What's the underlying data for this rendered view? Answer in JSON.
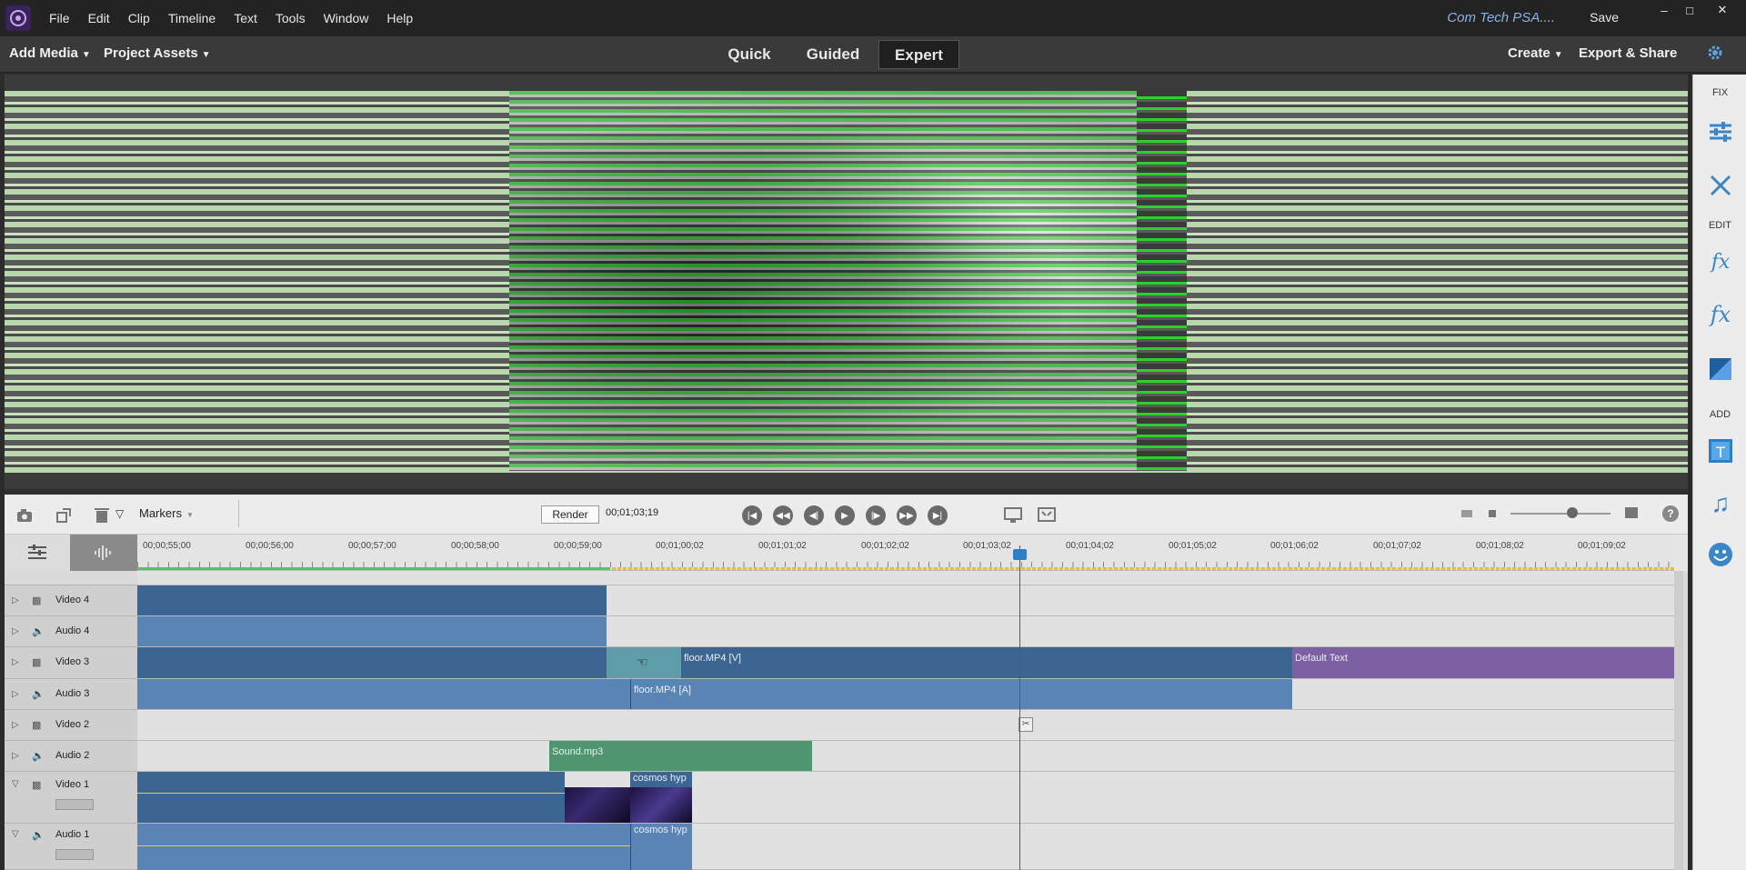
{
  "app": {
    "menu": [
      "File",
      "Edit",
      "Clip",
      "Timeline",
      "Text",
      "Tools",
      "Window",
      "Help"
    ],
    "doc_title": "Com Tech PSA....",
    "save_label": "Save",
    "window_controls": [
      "minimize-icon",
      "maximize-icon",
      "close-icon"
    ]
  },
  "toolbar": {
    "add_media": "Add Media",
    "project_assets": "Project Assets",
    "modes": [
      "Quick",
      "Guided",
      "Expert"
    ],
    "active_mode": "Expert",
    "create": "Create",
    "export_share": "Export & Share"
  },
  "right_panel": {
    "sections": [
      "FIX",
      "EDIT",
      "ADD"
    ],
    "fix_icons": [
      "adjust-sliders-icon",
      "tools-icon"
    ],
    "edit_icons": [
      "applied-effects-icon",
      "effects-icon",
      "transitions-icon"
    ],
    "add_icons": [
      "titles-icon",
      "music-icon",
      "graphics-icon"
    ]
  },
  "timeline_controls": {
    "markers_label": "Markers",
    "render_label": "Render",
    "timecode": "00;01;03;19",
    "transport_icons": [
      "go-to-start-icon",
      "rewind-icon",
      "step-back-icon",
      "play-icon",
      "step-forward-icon",
      "fast-forward-icon",
      "go-to-end-icon"
    ]
  },
  "ruler": {
    "labels": [
      "00;00;55;00",
      "00;00;56;00",
      "00;00;57;00",
      "00;00;58;00",
      "00;00;59;00",
      "00;01;00;02",
      "00;01;01;02",
      "00;01;02;02",
      "00;01;03;02",
      "00;01;04;02",
      "00;01;05;02",
      "00;01;06;02",
      "00;01;07;02",
      "00;01;08;02",
      "00;01;09;02"
    ]
  },
  "tracks": [
    {
      "name": "Video 4",
      "kind": "video"
    },
    {
      "name": "Audio 4",
      "kind": "audio"
    },
    {
      "name": "Video 3",
      "kind": "video"
    },
    {
      "name": "Audio 3",
      "kind": "audio"
    },
    {
      "name": "Video 2",
      "kind": "video"
    },
    {
      "name": "Audio 2",
      "kind": "audio"
    },
    {
      "name": "Video 1",
      "kind": "video"
    },
    {
      "name": "Audio 1",
      "kind": "audio"
    }
  ],
  "clips": {
    "floor_v": "floor.MP4 [V]",
    "default_text": "Default Text",
    "floor_a": "floor.MP4 [A]",
    "sound": "Sound.mp3",
    "cosmos_v": "cosmos hyp",
    "cosmos_a": "cosmos hyp"
  },
  "colors": {
    "video_clip": "#3d6592",
    "audio_clip": "#5a84b3",
    "title_clip": "#7d5fa3",
    "sound_clip": "#4f9670",
    "playhead": "#e02020"
  }
}
